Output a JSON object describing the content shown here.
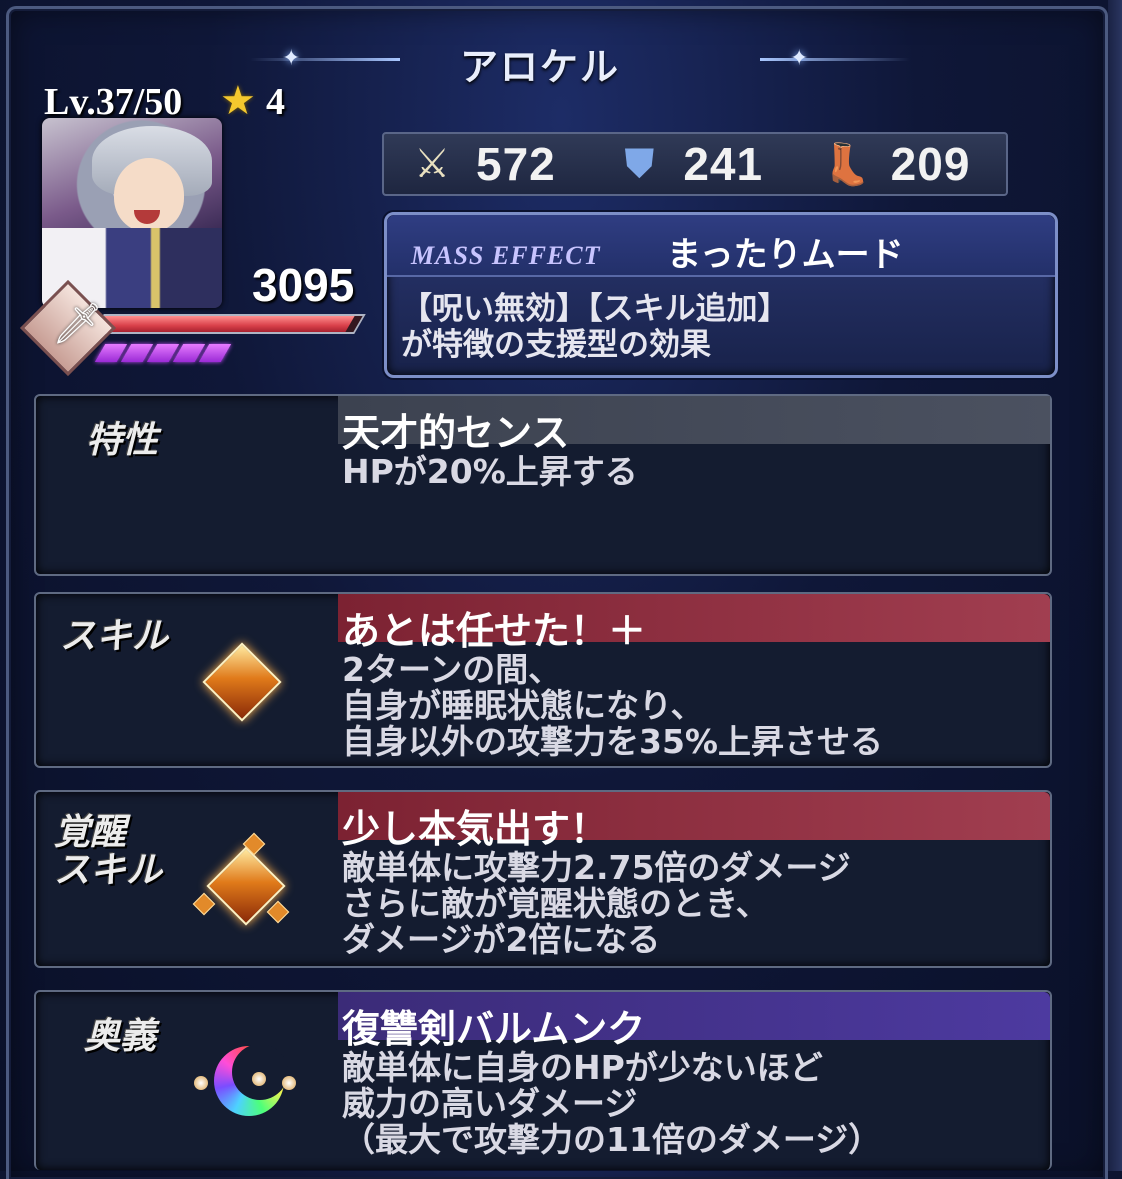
{
  "character": {
    "name": "アロケル",
    "level_label": "Lv.37/50",
    "rarity": "4",
    "hp": "3095",
    "hp_fraction": 0.97,
    "gauge_segments": 5
  },
  "stats": {
    "attack": "572",
    "defense": "241",
    "speed": "209"
  },
  "mass_effect": {
    "label": "MASS EFFECT",
    "name": "まったりムード",
    "description": "【呪い無効】【スキル追加】\nが特徴の支援型の効果"
  },
  "trait": {
    "label": "特性",
    "title": "天才的センス",
    "description": "HPが20%上昇する"
  },
  "skill": {
    "label": "スキル",
    "title": "あとは任せた！＋",
    "description": "2ターンの間、\n自身が睡眠状態になり、\n自身以外の攻撃力を35%上昇させる"
  },
  "awaken_skill": {
    "label": "覚醒\nスキル",
    "title": "少し本気出す！",
    "description": "敵単体に攻撃力2.75倍のダメージ\nさらに敵が覚醒状態のとき、\nダメージが2倍になる"
  },
  "ultimate": {
    "label": "奥義",
    "title": "復讐剣バルムンク",
    "description": "敵単体に自身のHPが少ないほど\n威力の高いダメージ\n（最大で攻撃力の11倍のダメージ）"
  },
  "icons": {
    "attack": "sword-icon",
    "defense": "shield-icon",
    "speed": "boot-icon",
    "rarity": "star-icon",
    "class": "sword-class-icon",
    "skill": "orange-gem-icon",
    "ultimate": "rainbow-moon-icon"
  }
}
